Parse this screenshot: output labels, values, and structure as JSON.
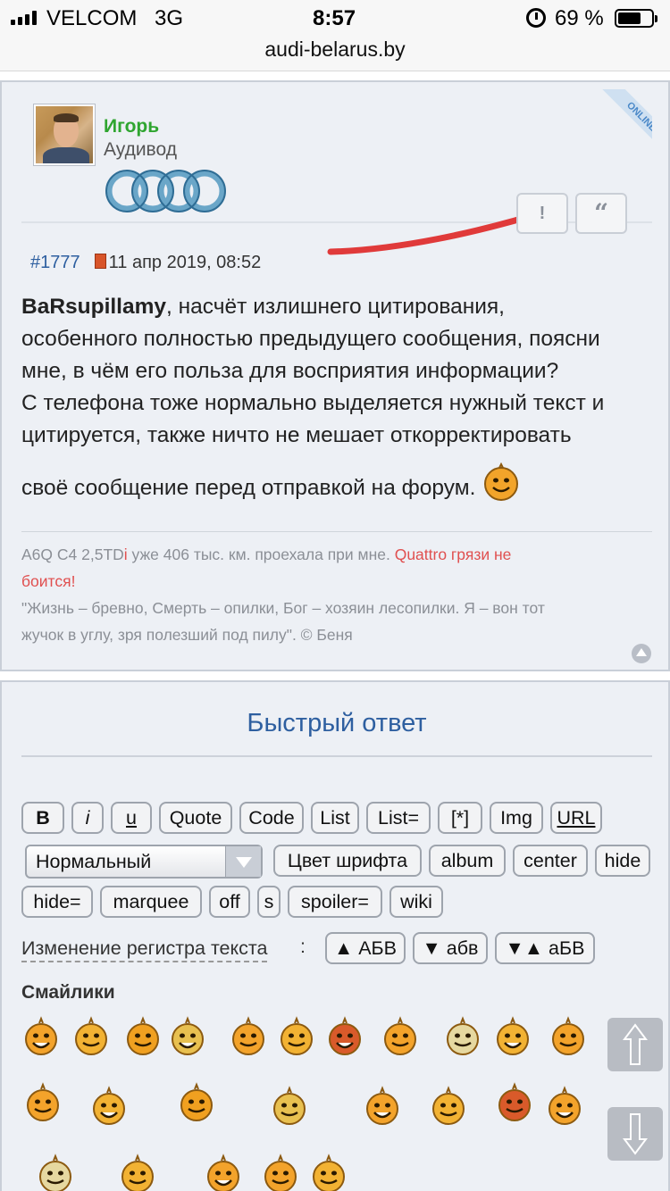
{
  "status_bar": {
    "carrier": "VELCOM",
    "network": "3G",
    "time": "8:57",
    "battery_percent": "69 %",
    "battery_level": 0.69
  },
  "browser": {
    "url": "audi-belarus.by"
  },
  "post": {
    "author_name": "Игорь",
    "author_title": "Аудивод",
    "online_badge": "ONLINE",
    "report_label": "!",
    "quote_label": "“",
    "number": "#1777",
    "date": "11 апр 2019, 08:52",
    "quoted_user": "BaRsupillamy",
    "body_lines": [
      ", насчёт излишнего цитирования,",
      "особенного полностью предыдущего сообщения, поясни",
      "мне, в чём его польза для восприятия информации?",
      "С телефона тоже нормально выделяется нужный текст и",
      "цитируется, также ничто не мешает откорректировать",
      "своё сообщение перед отправкой на форум."
    ],
    "signature_line1_a": "A6Q C4 2,5TD",
    "signature_line1_i": "i",
    "signature_line1_b": " уже 406 тыс. км. проехала при мне. ",
    "signature_line1_red": "Quattro грязи не",
    "signature_line2_red": "боится!",
    "signature_line3": "\"Жизнь – бревно, Смерть – опилки, Бог – хозяин лесопилки. Я – вон тот",
    "signature_line4": "жучок в углу, зря полезший под пилу\". © Беня"
  },
  "quick_reply": {
    "title": "Быстрый ответ",
    "toolbar_row1": [
      "B",
      "i",
      "u",
      "Quote",
      "Code",
      "List",
      "List=",
      "[*]",
      "Img",
      "URL"
    ],
    "font_size_select": "Нормальный",
    "toolbar_row2": [
      "Цвет шрифта",
      "album",
      "center",
      "hide"
    ],
    "toolbar_row3": [
      "hide=",
      "marquee",
      "off",
      "s",
      "spoiler=",
      "wiki"
    ],
    "case_label": "Изменение регистра текста",
    "case_colon": ":",
    "case_buttons": [
      "▲ АБВ",
      "▼ абв",
      "▼▲ аБВ"
    ],
    "smilies_title": "Смайлики"
  },
  "icons": [
    "signal-icon",
    "alarm-icon",
    "battery-icon",
    "report-icon",
    "quote-icon",
    "post-icon",
    "to-top-icon",
    "scroll-up-icon",
    "scroll-down-icon"
  ],
  "colors": {
    "username": "#2fa530",
    "link": "#2e5fa0",
    "signature_red": "#e05050",
    "panel": "#edf0f5"
  }
}
